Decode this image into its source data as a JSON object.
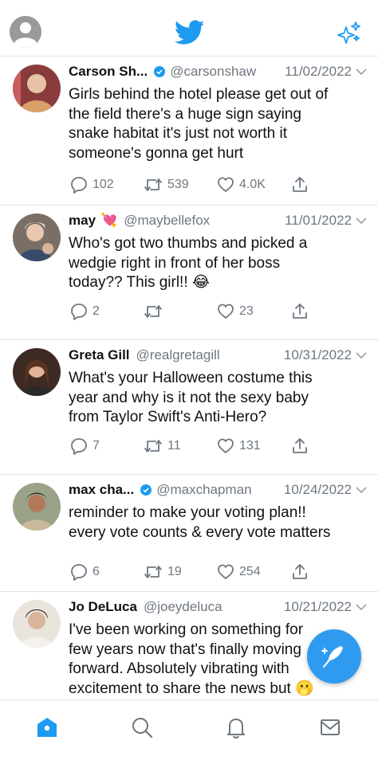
{
  "tweets": [
    {
      "name": "Carson Sh...",
      "verified": true,
      "handle": "@carsonshaw",
      "date": "11/02/2022",
      "lines": [
        "Girls behind the hotel please get out of",
        "the field there's a huge sign saying",
        "snake habitat it's just not worth it",
        "someone's gonna get hurt"
      ],
      "replies": "102",
      "retweets": "539",
      "likes": "4.0K"
    },
    {
      "name": "may",
      "emoji": "💘",
      "verified": false,
      "handle": "@maybellefox",
      "date": "11/01/2022",
      "lines": [
        "Who's got two thumbs and picked a",
        "wedgie right in front of her boss",
        "today?? This girl!! 😂"
      ],
      "replies": "2",
      "retweets": "",
      "likes": "23"
    },
    {
      "name": "Greta Gill",
      "verified": false,
      "handle": "@realgretagill",
      "date": "10/31/2022",
      "lines": [
        "What's your Halloween costume this",
        "year and why is it not the sexy baby",
        "from Taylor Swift's Anti-Hero?"
      ],
      "replies": "7",
      "retweets": "11",
      "likes": "131"
    },
    {
      "name": "max cha...",
      "verified": true,
      "handle": "@maxchapman",
      "date": "10/24/2022",
      "lines": [
        "reminder to make your voting plan!!",
        "every vote counts & every vote matters"
      ],
      "replies": "6",
      "retweets": "19",
      "likes": "254"
    },
    {
      "name": "Jo DeLuca",
      "verified": false,
      "handle": "@joeydeluca",
      "date": "10/21/2022",
      "lines": [
        "I've been working on something for",
        "few years now that's finally moving",
        "forward. Absolutely vibrating with",
        "excitement to share the news but 🫢"
      ],
      "replies": "",
      "retweets": "",
      "likes": ""
    }
  ],
  "colors": {
    "accent": "#1d9bf0",
    "secondary_text": "#6e7780",
    "divider": "#e3e3e3"
  },
  "icons": {
    "top": [
      "profile-icon",
      "twitter-bird-icon",
      "sparkle-icon"
    ],
    "bottom": [
      "home-icon",
      "search-icon",
      "notifications-icon",
      "messages-icon"
    ],
    "fab": "compose-feather-icon"
  }
}
